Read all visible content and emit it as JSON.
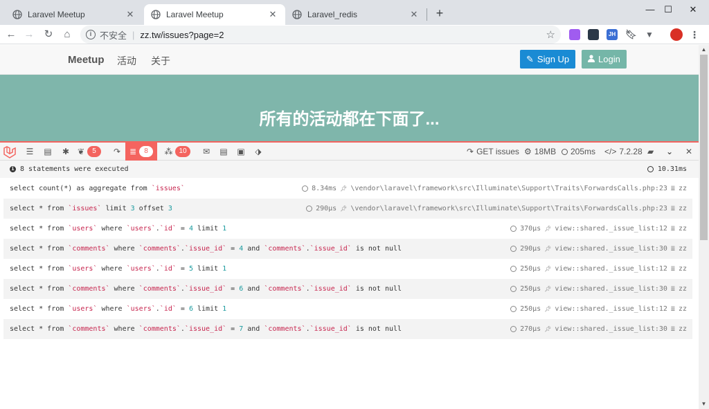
{
  "browser": {
    "tabs": [
      {
        "title": "Laravel Meetup",
        "active": false
      },
      {
        "title": "Laravel Meetup",
        "active": true
      },
      {
        "title": "Laravel_redis",
        "active": false
      }
    ],
    "address": {
      "security_label": "不安全",
      "url": "zz.tw/issues?page=2"
    },
    "extensions": [
      "purple-ext",
      "dark-ext",
      "JH",
      "bookmark-ext",
      "vue-ext",
      "avatar"
    ]
  },
  "site": {
    "brand": "Meetup",
    "nav": [
      "活动",
      "关于"
    ],
    "signup_label": "Sign Up",
    "login_label": "Login",
    "hero_title": "所有的活动都在下面了..."
  },
  "debugbar": {
    "queries_badge": "8",
    "views_badge": "5",
    "models_badge": "10",
    "route": "GET issues",
    "memory": "18MB",
    "time": "205ms",
    "php_version": "7.2.28",
    "summary": "8 statements were executed",
    "total_time": "10.31ms",
    "statements": [
      {
        "parts": [
          [
            "kw",
            "select count(*) as aggregate from "
          ],
          [
            "str",
            "`issues`"
          ]
        ],
        "duration": "8.34ms",
        "source": "\\vendor\\laravel\\framework\\src\\Illuminate\\Support\\Traits\\ForwardsCalls.php:23",
        "connection": "zz"
      },
      {
        "parts": [
          [
            "kw",
            "select * from "
          ],
          [
            "str",
            "`issues`"
          ],
          [
            "kw",
            " limit "
          ],
          [
            "num",
            "3"
          ],
          [
            "kw",
            " offset "
          ],
          [
            "num",
            "3"
          ]
        ],
        "duration": "290μs",
        "source": "\\vendor\\laravel\\framework\\src\\Illuminate\\Support\\Traits\\ForwardsCalls.php:23",
        "connection": "zz"
      },
      {
        "parts": [
          [
            "kw",
            "select * from "
          ],
          [
            "str",
            "`users`"
          ],
          [
            "kw",
            " where "
          ],
          [
            "str",
            "`users`"
          ],
          [
            "kw",
            "."
          ],
          [
            "str",
            "`id`"
          ],
          [
            "kw",
            " = "
          ],
          [
            "num",
            "4"
          ],
          [
            "kw",
            " limit "
          ],
          [
            "num",
            "1"
          ]
        ],
        "duration": "370μs",
        "source": "view::shared._issue_list:12",
        "connection": "zz"
      },
      {
        "parts": [
          [
            "kw",
            "select * from "
          ],
          [
            "str",
            "`comments`"
          ],
          [
            "kw",
            " where "
          ],
          [
            "str",
            "`comments`"
          ],
          [
            "kw",
            "."
          ],
          [
            "str",
            "`issue_id`"
          ],
          [
            "kw",
            " = "
          ],
          [
            "num",
            "4"
          ],
          [
            "kw",
            " and "
          ],
          [
            "str",
            "`comments`"
          ],
          [
            "kw",
            "."
          ],
          [
            "str",
            "`issue_id`"
          ],
          [
            "kw",
            " is not null"
          ]
        ],
        "duration": "290μs",
        "source": "view::shared._issue_list:30",
        "connection": "zz"
      },
      {
        "parts": [
          [
            "kw",
            "select * from "
          ],
          [
            "str",
            "`users`"
          ],
          [
            "kw",
            " where "
          ],
          [
            "str",
            "`users`"
          ],
          [
            "kw",
            "."
          ],
          [
            "str",
            "`id`"
          ],
          [
            "kw",
            " = "
          ],
          [
            "num",
            "5"
          ],
          [
            "kw",
            " limit "
          ],
          [
            "num",
            "1"
          ]
        ],
        "duration": "250μs",
        "source": "view::shared._issue_list:12",
        "connection": "zz"
      },
      {
        "parts": [
          [
            "kw",
            "select * from "
          ],
          [
            "str",
            "`comments`"
          ],
          [
            "kw",
            " where "
          ],
          [
            "str",
            "`comments`"
          ],
          [
            "kw",
            "."
          ],
          [
            "str",
            "`issue_id`"
          ],
          [
            "kw",
            " = "
          ],
          [
            "num",
            "6"
          ],
          [
            "kw",
            " and "
          ],
          [
            "str",
            "`comments`"
          ],
          [
            "kw",
            "."
          ],
          [
            "str",
            "`issue_id`"
          ],
          [
            "kw",
            " is not null"
          ]
        ],
        "duration": "250μs",
        "source": "view::shared._issue_list:30",
        "connection": "zz"
      },
      {
        "parts": [
          [
            "kw",
            "select * from "
          ],
          [
            "str",
            "`users`"
          ],
          [
            "kw",
            " where "
          ],
          [
            "str",
            "`users`"
          ],
          [
            "kw",
            "."
          ],
          [
            "str",
            "`id`"
          ],
          [
            "kw",
            " = "
          ],
          [
            "num",
            "6"
          ],
          [
            "kw",
            " limit "
          ],
          [
            "num",
            "1"
          ]
        ],
        "duration": "250μs",
        "source": "view::shared._issue_list:12",
        "connection": "zz"
      },
      {
        "parts": [
          [
            "kw",
            "select * from "
          ],
          [
            "str",
            "`comments`"
          ],
          [
            "kw",
            " where "
          ],
          [
            "str",
            "`comments`"
          ],
          [
            "kw",
            "."
          ],
          [
            "str",
            "`issue_id`"
          ],
          [
            "kw",
            " = "
          ],
          [
            "num",
            "7"
          ],
          [
            "kw",
            " and "
          ],
          [
            "str",
            "`comments`"
          ],
          [
            "kw",
            "."
          ],
          [
            "str",
            "`issue_id`"
          ],
          [
            "kw",
            " is not null"
          ]
        ],
        "duration": "270μs",
        "source": "view::shared._issue_list:30",
        "connection": "zz"
      }
    ]
  },
  "colors": {
    "hero": "#7fb6ab",
    "debugbar_accent": "#f4645f",
    "primary": "#1a8bd4",
    "success": "#75b6a8"
  }
}
